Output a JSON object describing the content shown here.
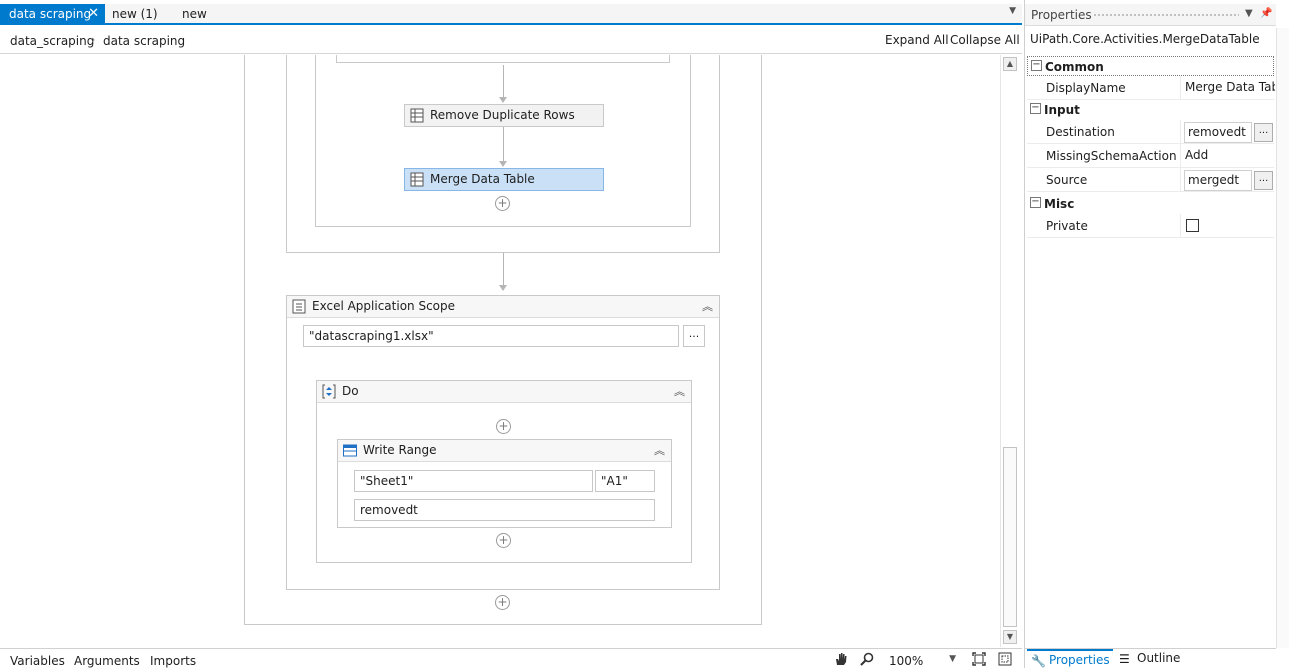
{
  "tabs": [
    {
      "label": "data scraping",
      "active": true
    },
    {
      "label": "new (1)",
      "active": false
    },
    {
      "label": "new",
      "active": false
    }
  ],
  "breadcrumb": {
    "items": [
      "data_scraping",
      "data scraping"
    ]
  },
  "toolbar": {
    "expand_all": "Expand All",
    "collapse_all": "Collapse All"
  },
  "workflow": {
    "remove_duplicates": "Remove Duplicate Rows",
    "merge_data_table": "Merge Data Table",
    "excel_scope": {
      "title": "Excel Application Scope",
      "path": "\"datascraping1.xlsx\"",
      "ellipsis": "..."
    },
    "do_seq": {
      "title": "Do"
    },
    "write_range": {
      "title": "Write Range",
      "sheet": "\"Sheet1\"",
      "cell": "\"A1\"",
      "datatable": "removedt"
    }
  },
  "bottom_tabs": [
    "Variables",
    "Arguments",
    "Imports"
  ],
  "zoom": {
    "value": "100%"
  },
  "properties": {
    "title": "Properties",
    "type_name": "UiPath.Core.Activities.MergeDataTable",
    "categories": {
      "common": "Common",
      "input": "Input",
      "misc": "Misc"
    },
    "rows": {
      "display_name": {
        "name": "DisplayName",
        "value": "Merge Data Table"
      },
      "destination": {
        "name": "Destination",
        "value": "removedt"
      },
      "missing_schema": {
        "name": "MissingSchemaAction",
        "value": "Add"
      },
      "source": {
        "name": "Source",
        "value": "mergedt"
      },
      "private": {
        "name": "Private",
        "checked": false
      }
    },
    "dots": "..."
  },
  "panel_tabs": {
    "properties": "Properties",
    "outline": "Outline"
  },
  "colors": {
    "accent": "#007acc",
    "selected_activity": "#c9e0f7"
  }
}
